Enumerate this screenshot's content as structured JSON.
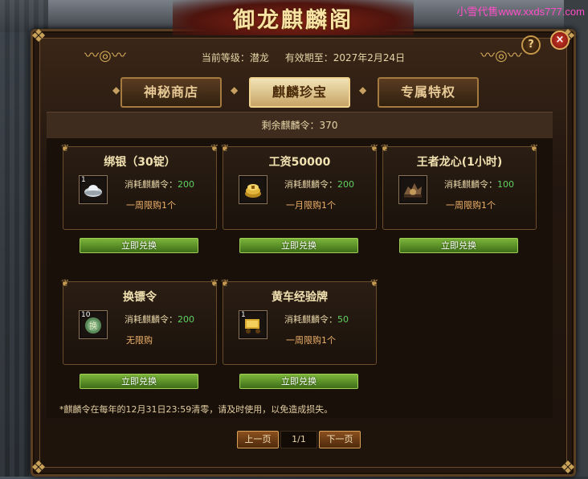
{
  "title": "御龙麒麟阁",
  "watermark": "小雪代售www.xxds777.com",
  "header": {
    "level_label": "当前等级：潜龙",
    "expiry_label": "有效期至：2027年2月24日",
    "help": "?",
    "close": "×"
  },
  "tabs": [
    {
      "label": "神秘商店"
    },
    {
      "label": "麒麟珍宝"
    },
    {
      "label": "专属特权"
    }
  ],
  "remaining": "剩余麒麟令：370",
  "items": [
    {
      "name": "绑银（30锭）",
      "cost_label": "消耗麒麟令：",
      "cost": "200",
      "limit": "一周限购1个",
      "count": "1",
      "button": "立即兑换"
    },
    {
      "name": "工资50000",
      "cost_label": "消耗麒麟令：",
      "cost": "200",
      "limit": "一月限购1个",
      "count": "",
      "button": "立即兑换"
    },
    {
      "name": "王者龙心(1小时)",
      "cost_label": "消耗麒麟令：",
      "cost": "100",
      "limit": "一周限购1个",
      "count": "",
      "button": "立即兑换"
    },
    {
      "name": "换镖令",
      "cost_label": "消耗麒麟令：",
      "cost": "200",
      "limit": "无限购",
      "count": "10",
      "button": "立即兑换"
    },
    {
      "name": "黄车经验牌",
      "cost_label": "消耗麒麟令：",
      "cost": "50",
      "limit": "一周限购1个",
      "count": "1",
      "button": "立即兑换"
    }
  ],
  "footnote": "*麒麟令在每年的12月31日23:59清零，请及时使用，以免造成损失。",
  "pager": {
    "prev": "上一页",
    "page": "1/1",
    "next": "下一页"
  },
  "colors": {
    "accent": "#c6984a",
    "cost_value": "#5fd25f",
    "limit_text": "#f0b26a",
    "button": "#5a8f28"
  },
  "icons": [
    "silver-ingot-icon",
    "gold-coins-icon",
    "dragon-heart-icon",
    "escort-token-icon",
    "gold-cart-icon"
  ]
}
